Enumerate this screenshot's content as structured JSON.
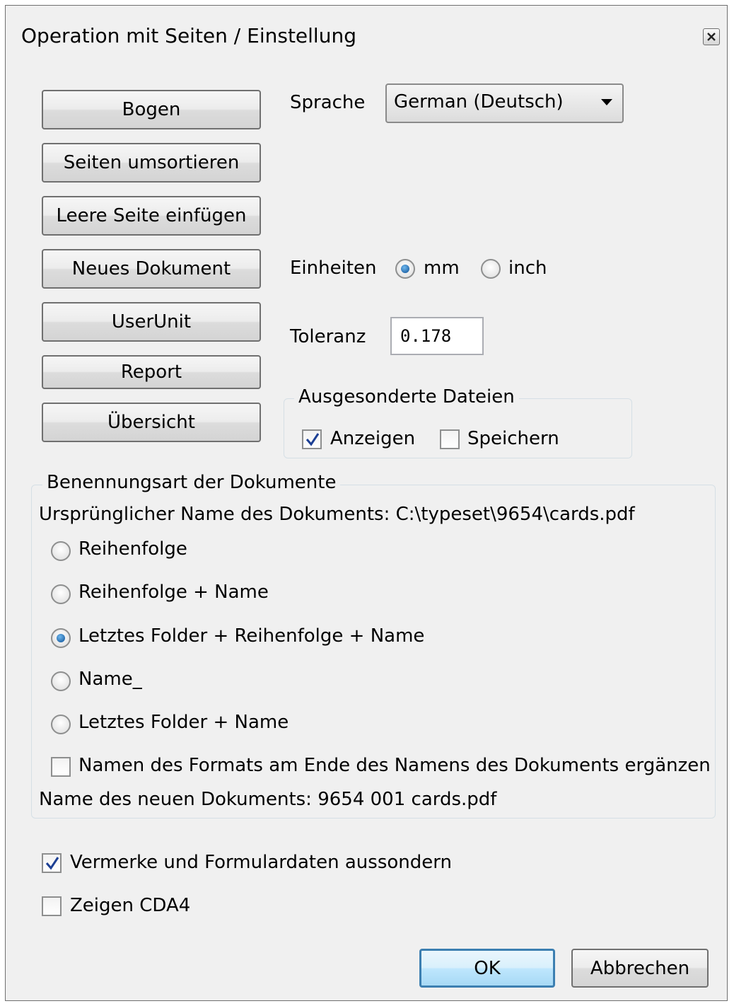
{
  "window": {
    "title": "Operation mit Seiten / Einstellung"
  },
  "buttons": {
    "bogen": "Bogen",
    "seiten_umsortieren": "Seiten umsortieren",
    "leere_seite": "Leere Seite einfügen",
    "neues_dokument": "Neues Dokument",
    "userunit": "UserUnit",
    "report": "Report",
    "uebersicht": "Übersicht",
    "ok": "OK",
    "abbrechen": "Abbrechen"
  },
  "language": {
    "label": "Sprache",
    "selected": "German (Deutsch)"
  },
  "units": {
    "label": "Einheiten",
    "options": [
      "mm",
      "inch"
    ],
    "selected": "mm"
  },
  "tolerance": {
    "label": "Toleranz",
    "value": "0.178"
  },
  "discarded_files": {
    "legend": "Ausgesonderte Dateien",
    "show": {
      "label": "Anzeigen",
      "checked": true
    },
    "save": {
      "label": "Speichern",
      "checked": false
    }
  },
  "naming": {
    "legend": "Benennungsart der Dokumente",
    "original_name": "Ursprünglicher Name des Dokuments: C:\\typeset\\9654\\cards.pdf",
    "options": [
      "Reihenfolge",
      "Reihenfolge + Name",
      "Letztes Folder + Reihenfolge + Name",
      "Name_",
      "Letztes Folder + Name"
    ],
    "selected_index": 2,
    "append_format": {
      "label": "Namen des Formats am Ende des Namens des Dokuments ergänzen",
      "checked": false
    },
    "new_name": "Name des neuen Dokuments: 9654 001 cards.pdf"
  },
  "annotations": {
    "label": "Vermerke und Formulardaten aussondern",
    "checked": true
  },
  "show_cda4": {
    "label": "Zeigen CDA4",
    "checked": false
  },
  "colors": {
    "accent": "#3c7fb1",
    "radio_dot": "#0b4e93",
    "checkmark": "#1c3f94"
  }
}
